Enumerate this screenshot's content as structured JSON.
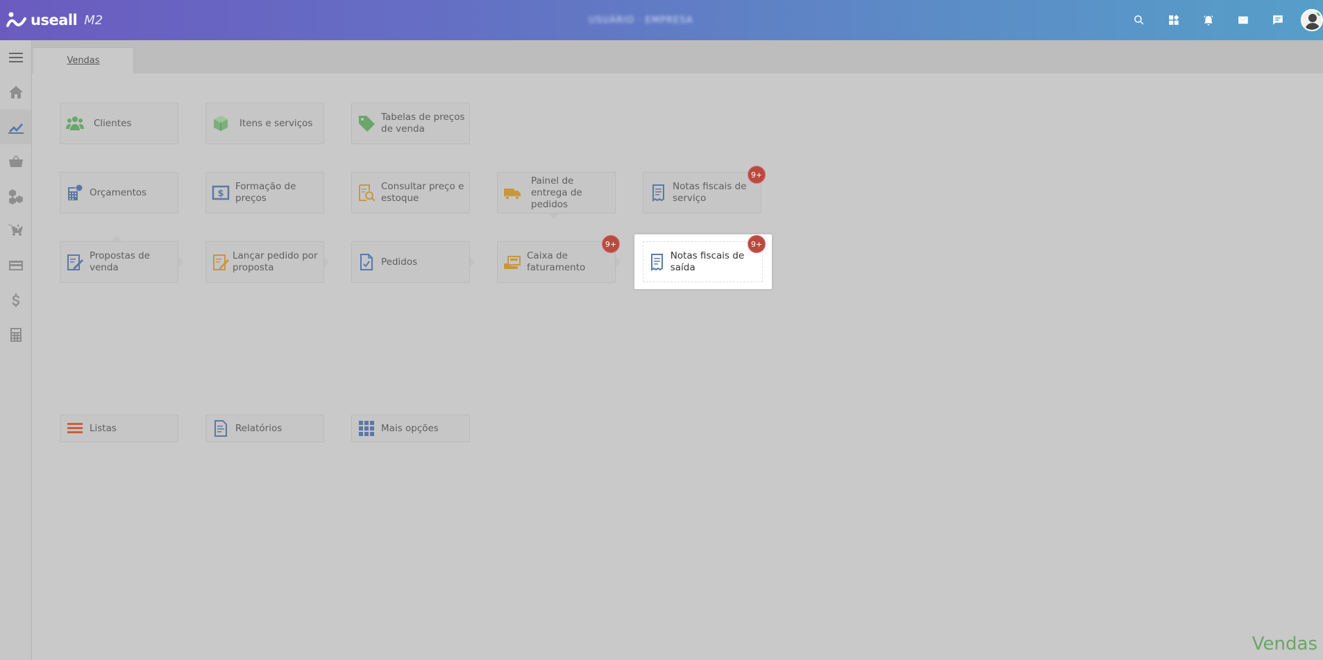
{
  "app": {
    "logo_text": "useall",
    "logo_sub": "M2",
    "blurred_user": "USUÁRIO · EMPRESA"
  },
  "tabs": [
    {
      "label": "Vendas"
    }
  ],
  "cards": {
    "clientes": "Clientes",
    "itens": "Itens e serviços",
    "tabelas": "Tabelas de preços de venda",
    "orcamentos": "Orçamentos",
    "formacao": "Formação de preços",
    "consultar": "Consultar preço e estoque",
    "painel": "Painel de entrega de pedidos",
    "nfs_servico": "Notas fiscais de serviço",
    "propostas": "Propostas de venda",
    "lancar": "Lançar pedido por proposta",
    "pedidos": "Pedidos",
    "caixa": "Caixa de faturamento",
    "nfs_saida": "Notas fiscais de saída",
    "listas": "Listas",
    "relatorios": "Relatórios",
    "mais": "Mais opções"
  },
  "badges": {
    "nfs_servico": "9+",
    "caixa": "9+",
    "nfs_saida": "9+"
  },
  "module_title": "Vendas",
  "colors": {
    "accent": "#6b5bc0",
    "badge": "#b94a3f",
    "module": "#6aa56a"
  }
}
